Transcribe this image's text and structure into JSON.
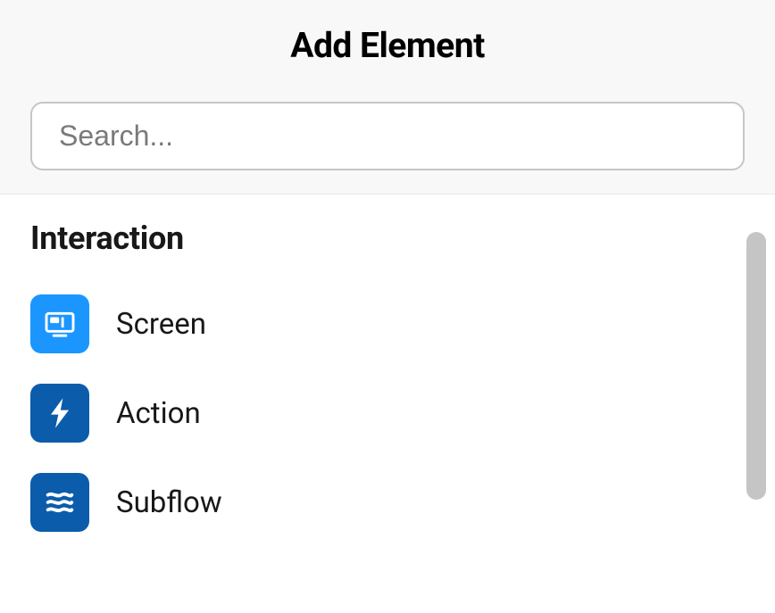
{
  "header": {
    "title": "Add Element",
    "search_placeholder": "Search..."
  },
  "sections": {
    "interaction": {
      "label": "Interaction",
      "items": [
        {
          "label": "Screen"
        },
        {
          "label": "Action"
        },
        {
          "label": "Subflow"
        }
      ]
    }
  },
  "colors": {
    "icon_screen_bg": "#1b96ff",
    "icon_action_bg": "#0b5cab",
    "icon_subflow_bg": "#0b5cab"
  }
}
